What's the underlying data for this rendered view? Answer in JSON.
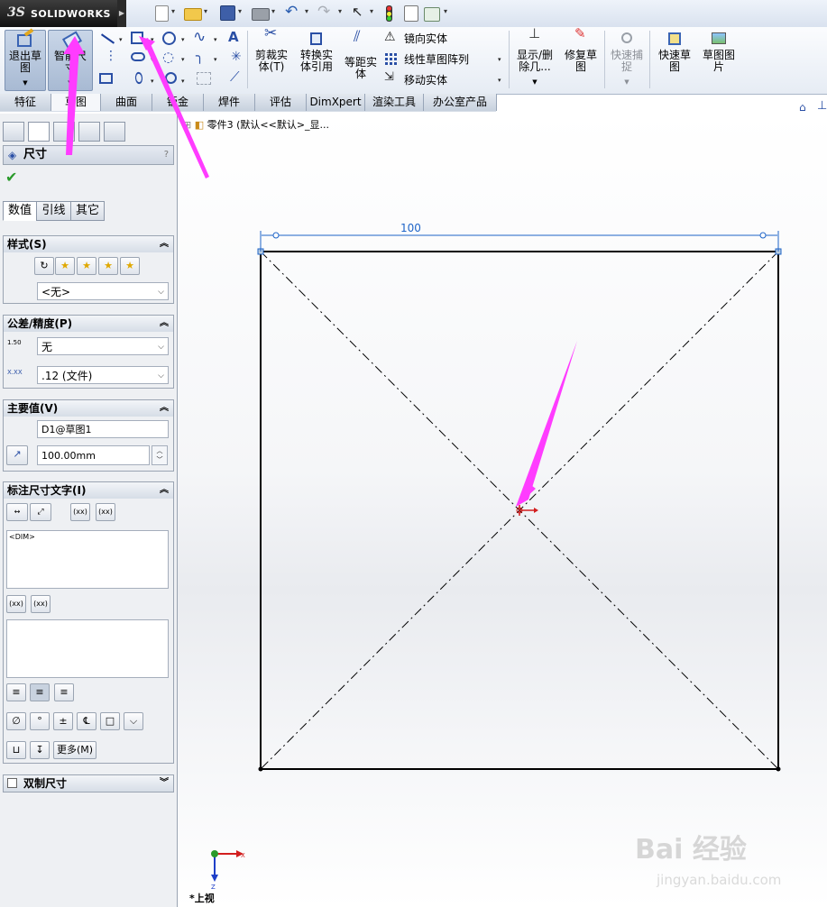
{
  "app": {
    "logo_ds": "3S",
    "logo_name": "SOLIDWORKS"
  },
  "ribbon": {
    "exit_sketch": [
      "退出草",
      "图"
    ],
    "smart_dimension": [
      "智能尺",
      "寸"
    ],
    "trim": [
      "剪裁实",
      "体(T)"
    ],
    "convert": [
      "转换实",
      "体引用"
    ],
    "offset": [
      "等距实",
      "体"
    ],
    "mirror": "镜向实体",
    "linear_pattern": "线性草图阵列",
    "move": "移动实体",
    "display_delete": [
      "显示/删",
      "除几..."
    ],
    "repair": [
      "修复草",
      "图"
    ],
    "quick_snap": [
      "快速捕",
      "捉"
    ],
    "rapid_sketch": [
      "快速草",
      "图"
    ],
    "sketch_picture": [
      "草图图",
      "片"
    ]
  },
  "tabs": [
    "特征",
    "草图",
    "曲面",
    "钣金",
    "焊件",
    "评估",
    "DimXpert",
    "渲染工具",
    "办公室产品"
  ],
  "active_tab": "草图",
  "panel": {
    "title": "尺寸",
    "help": "?",
    "subtabs": [
      "数值",
      "引线",
      "其它"
    ],
    "style": {
      "title": "样式(S)",
      "value": "<无>"
    },
    "tolerance": {
      "title": "公差/精度(P)",
      "tol_icon": "1.50",
      "tol_value": "无",
      "prec_icon": "X.XX",
      "prec_value": ".12 (文件)"
    },
    "primary": {
      "title": "主要值(V)",
      "name": "D1@草图1",
      "value": "100.00mm"
    },
    "dimtext": {
      "title": "标注尺寸文字(I)",
      "text": "<DIM>",
      "paren": "(xx)",
      "more": "更多(M)"
    },
    "dual": {
      "title": "双制尺寸"
    }
  },
  "canvas": {
    "breadcrumb": "零件3 (默认<<默认>_显...",
    "dimension_value": "100",
    "view_label": "*上视",
    "axis_x": "X",
    "axis_z": "Z"
  },
  "watermark": {
    "brand": "Bai  经验",
    "url": "jingyan.baidu.com"
  },
  "colors": {
    "annotation": "#ff3cff",
    "dimension": "#1e64c8",
    "origin": "#d21e1e"
  }
}
